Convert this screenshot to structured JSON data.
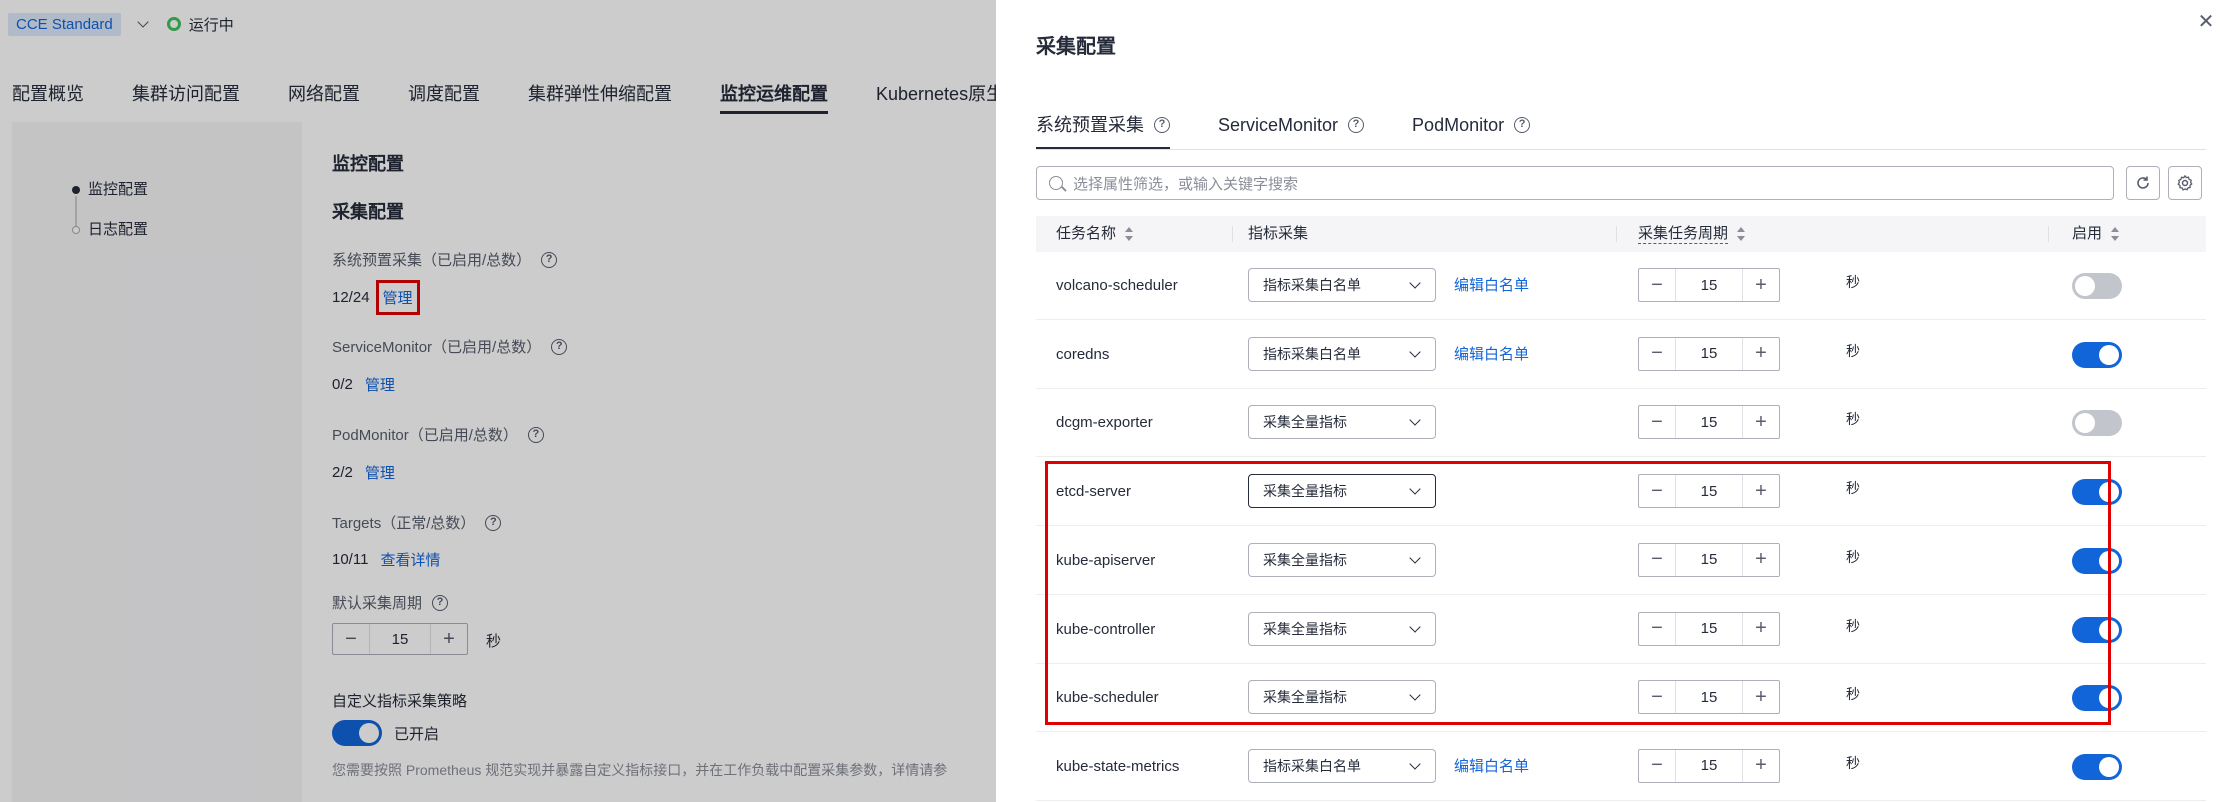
{
  "topbar": {
    "cluster_name": "CCE Standard",
    "status": "运行中"
  },
  "tabs": [
    "配置概览",
    "集群访问配置",
    "网络配置",
    "调度配置",
    "集群弹性伸缩配置",
    "监控运维配置",
    "Kubernetes原生"
  ],
  "side_nav": [
    "监控配置",
    "日志配置"
  ],
  "monitor": {
    "section_title": "监控配置",
    "collect_title": "采集配置",
    "preset_label": "系统预置采集（已启用/总数）",
    "preset_value": "12/24",
    "preset_link": "管理",
    "sm_label": "ServiceMonitor（已启用/总数）",
    "sm_value": "0/2",
    "sm_link": "管理",
    "pm_label": "PodMonitor（已启用/总数）",
    "pm_value": "2/2",
    "pm_link": "管理",
    "targets_label": "Targets（正常/总数）",
    "targets_value": "10/11",
    "targets_link": "查看详情",
    "period_label": "默认采集周期",
    "period_value": "15",
    "period_unit": "秒",
    "custom_label": "自定义指标采集策略",
    "custom_state": "已开启",
    "note": "您需要按照 Prometheus 规范实现并暴露自定义指标接口，并在工作负载中配置采集参数，详情请参"
  },
  "drawer": {
    "title": "采集配置",
    "tabs": [
      "系统预置采集",
      "ServiceMonitor",
      "PodMonitor"
    ],
    "search_placeholder": "选择属性筛选，或输入关键字搜索",
    "columns": [
      "任务名称",
      "指标采集",
      "采集任务周期",
      "启用"
    ],
    "unit": "秒",
    "rows": [
      {
        "name": "volcano-scheduler",
        "metric": "指标采集白名单",
        "edit": "编辑白名单",
        "period": "15",
        "enabled": false
      },
      {
        "name": "coredns",
        "metric": "指标采集白名单",
        "edit": "编辑白名单",
        "period": "15",
        "enabled": true
      },
      {
        "name": "dcgm-exporter",
        "metric": "采集全量指标",
        "edit": "",
        "period": "15",
        "enabled": false
      },
      {
        "name": "etcd-server",
        "metric": "采集全量指标",
        "edit": "",
        "period": "15",
        "enabled": true
      },
      {
        "name": "kube-apiserver",
        "metric": "采集全量指标",
        "edit": "",
        "period": "15",
        "enabled": true
      },
      {
        "name": "kube-controller",
        "metric": "采集全量指标",
        "edit": "",
        "period": "15",
        "enabled": true
      },
      {
        "name": "kube-scheduler",
        "metric": "采集全量指标",
        "edit": "",
        "period": "15",
        "enabled": true
      },
      {
        "name": "kube-state-metrics",
        "metric": "指标采集白名单",
        "edit": "编辑白名单",
        "period": "15",
        "enabled": true
      }
    ]
  },
  "colors": {
    "accent": "#1264d9",
    "highlight": "#e00000",
    "status_ok": "#3ec25a"
  }
}
